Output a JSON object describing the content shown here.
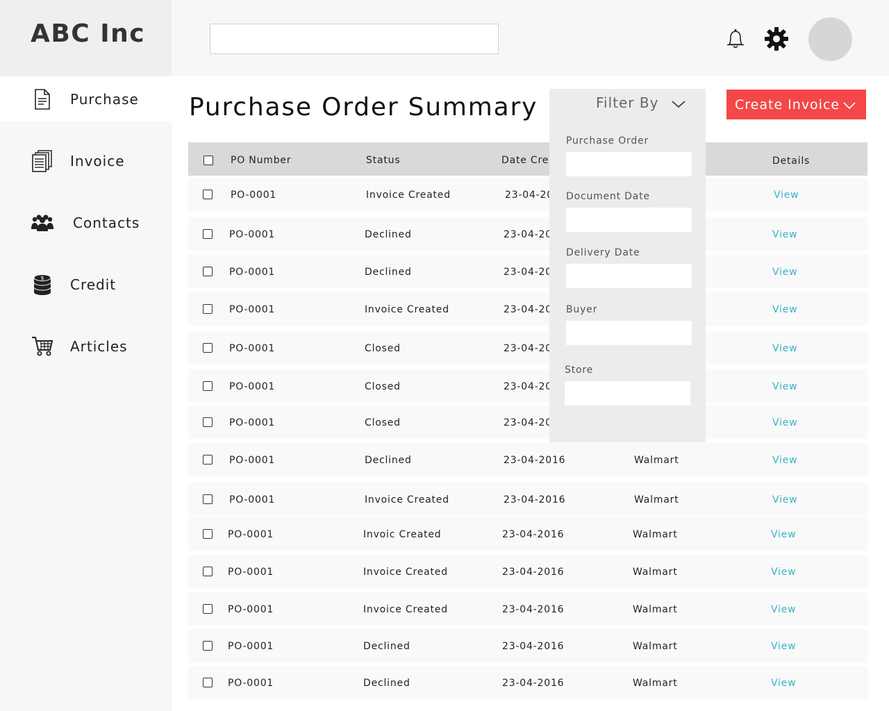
{
  "brand": {
    "name": "ABC Inc"
  },
  "search": {
    "value": "",
    "placeholder": ""
  },
  "sidebar": {
    "items": [
      {
        "label": "Purchase",
        "icon": "document-icon"
      },
      {
        "label": "Invoice",
        "icon": "documents-stack-icon"
      },
      {
        "label": "Contacts",
        "icon": "people-group-icon"
      },
      {
        "label": "Credit",
        "icon": "coin-stack-icon"
      },
      {
        "label": "Articles",
        "icon": "shopping-cart-icon"
      }
    ]
  },
  "header": {
    "icons": [
      "bell-icon",
      "gear-icon",
      "avatar"
    ]
  },
  "main": {
    "title": "Purchase Order Summary",
    "create_button_label": "Create Invoice"
  },
  "table": {
    "columns": [
      "PO Number",
      "Status",
      "Date Crea",
      "Details"
    ],
    "rows": [
      {
        "po": "PO-0001",
        "status": "Invoice Created",
        "date": "23-04-20",
        "store": "",
        "details": "View"
      },
      {
        "po": "PO-0001",
        "status": "Declined",
        "date": "23-04-20",
        "store": "",
        "details": "View"
      },
      {
        "po": "PO-0001",
        "status": "Declined",
        "date": "23-04-20",
        "store": "",
        "details": "View"
      },
      {
        "po": "PO-0001",
        "status": "Invoice Created",
        "date": "23-04-20",
        "store": "",
        "details": "View"
      },
      {
        "po": "PO-0001",
        "status": "Closed",
        "date": "23-04-20",
        "store": "",
        "details": "View"
      },
      {
        "po": "PO-0001",
        "status": "Closed",
        "date": "23-04-20",
        "store": "",
        "details": "View"
      },
      {
        "po": "PO-0001",
        "status": "Closed",
        "date": "23-04-20",
        "store": "",
        "details": "View"
      },
      {
        "po": "PO-0001",
        "status": "Declined",
        "date": "23-04-2016",
        "store": "Walmart",
        "details": "View"
      },
      {
        "po": "PO-0001",
        "status": "Invoice Created",
        "date": "23-04-2016",
        "store": "Walmart",
        "details": "View"
      },
      {
        "po": "PO-0001",
        "status": "Invoic Created",
        "date": "23-04-2016",
        "store": "Walmart",
        "details": "View"
      },
      {
        "po": "PO-0001",
        "status": "Invoice Created",
        "date": "23-04-2016",
        "store": "Walmart",
        "details": "View"
      },
      {
        "po": "PO-0001",
        "status": "Invoice Created",
        "date": "23-04-2016",
        "store": "Walmart",
        "details": "View"
      },
      {
        "po": "PO-0001",
        "status": "Declined",
        "date": "23-04-2016",
        "store": "Walmart",
        "details": "View"
      },
      {
        "po": "PO-0001",
        "status": "Declined",
        "date": "23-04-2016",
        "store": "Walmart",
        "details": "View"
      }
    ]
  },
  "filter": {
    "title": "Filter By",
    "fields": [
      {
        "label": "Purchase Order",
        "value": ""
      },
      {
        "label": "Document Date",
        "value": ""
      },
      {
        "label": "Delivery Date",
        "value": ""
      },
      {
        "label": "Buyer",
        "value": ""
      },
      {
        "label": "Store",
        "value": ""
      }
    ]
  },
  "colors": {
    "accent": "#f44848",
    "link": "#3ab0c8",
    "table_header": "#d9d9d9",
    "sidebar_bg": "#f7f7f7",
    "filter_bg": "#ececec"
  }
}
